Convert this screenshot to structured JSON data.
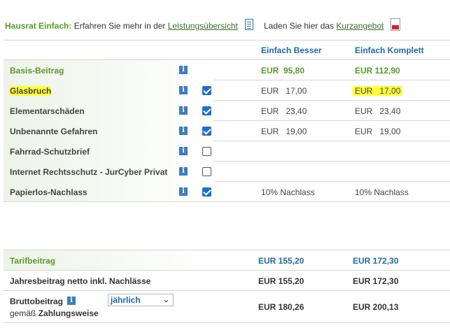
{
  "header": {
    "product": "Hausrat Einfach:",
    "text1": "Erfahren Sie mehr in der",
    "link1": "Leistungsübersicht",
    "text2": "Laden Sie hier das",
    "link2": "Kurzangebot",
    "doc_icon": "document-icon",
    "pdf_icon": "pdf-icon"
  },
  "columns": {
    "col1": "Einfach Besser",
    "col2": "Einfach Komplett"
  },
  "rows": [
    {
      "label": "Basis-Beitrag",
      "checked": null,
      "v1": "EUR  95,80",
      "v2": "EUR 112,90"
    },
    {
      "label": "Glasbruch",
      "checked": true,
      "v1": "EUR   17,00",
      "v2": "EUR   17,00"
    },
    {
      "label": "Elementarschäden",
      "checked": true,
      "v1": "EUR   23,40",
      "v2": "EUR   23,40"
    },
    {
      "label": "Unbenannte Gefahren",
      "checked": true,
      "v1": "EUR   19,00",
      "v2": "EUR   19,00"
    },
    {
      "label": "Fahrrad-Schutzbrief",
      "checked": false,
      "v1": "",
      "v2": ""
    },
    {
      "label": "Internet Rechtsschutz - JurCyber Privat",
      "checked": false,
      "v1": "",
      "v2": ""
    },
    {
      "label": "Papierlos-Nachlass",
      "checked": true,
      "v1": "10% Nachlass",
      "v2": "10% Nachlass"
    }
  ],
  "summary": {
    "tarif_label": "Tarifbeitrag",
    "tarif_v1": "EUR 155,20",
    "tarif_v2": "EUR 172,30",
    "jahr_label": "Jahresbeitrag netto inkl. Nachlässe",
    "jahr_v1": "EUR 155,20",
    "jahr_v2": "EUR 172,30",
    "brutto_label": "Bruttobeitrag",
    "brutto_sub1": "gemäß",
    "brutto_sub2": "Zahlungsweise",
    "brutto_v1": "EUR 180,26",
    "brutto_v2": "EUR 200,13",
    "zahlweise": "jährlich"
  },
  "info_glyph": "i",
  "colors": {
    "green": "#5a9a2c",
    "blue": "#1f6aa3",
    "highlight": "#ffff3b",
    "checkbox": "#1e6fd0"
  }
}
